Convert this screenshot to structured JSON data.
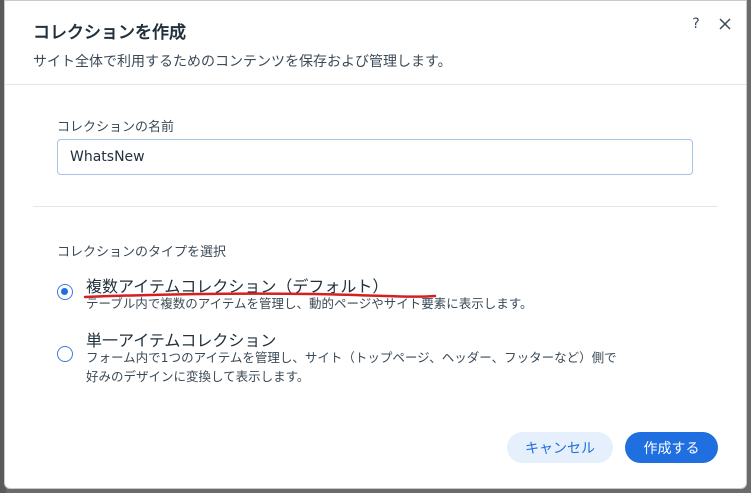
{
  "dialog": {
    "title": "コレクションを作成",
    "subtitle": "サイト全体で利用するためのコンテンツを保存および管理します。",
    "help_icon": "?",
    "close_icon": "close-icon"
  },
  "name_field": {
    "label": "コレクションの名前",
    "value": "WhatsNew"
  },
  "type_section": {
    "label": "コレクションのタイプを選択",
    "options": [
      {
        "title": "複数アイテムコレクション（デフォルト）",
        "description": "テーブル内で複数のアイテムを管理し、動的ページやサイト要素に表示します。",
        "selected": true
      },
      {
        "title": "単一アイテムコレクション",
        "description_line1": "フォーム内で1つのアイテムを管理し、サイト（トップページ、ヘッダー、フッターなど）側で",
        "description_line2": "好みのデザインに変換して表示します。",
        "selected": false
      }
    ]
  },
  "buttons": {
    "cancel": "キャンセル",
    "create": "作成する"
  },
  "colors": {
    "accent": "#1f6fe0",
    "annotation": "#d42020"
  }
}
